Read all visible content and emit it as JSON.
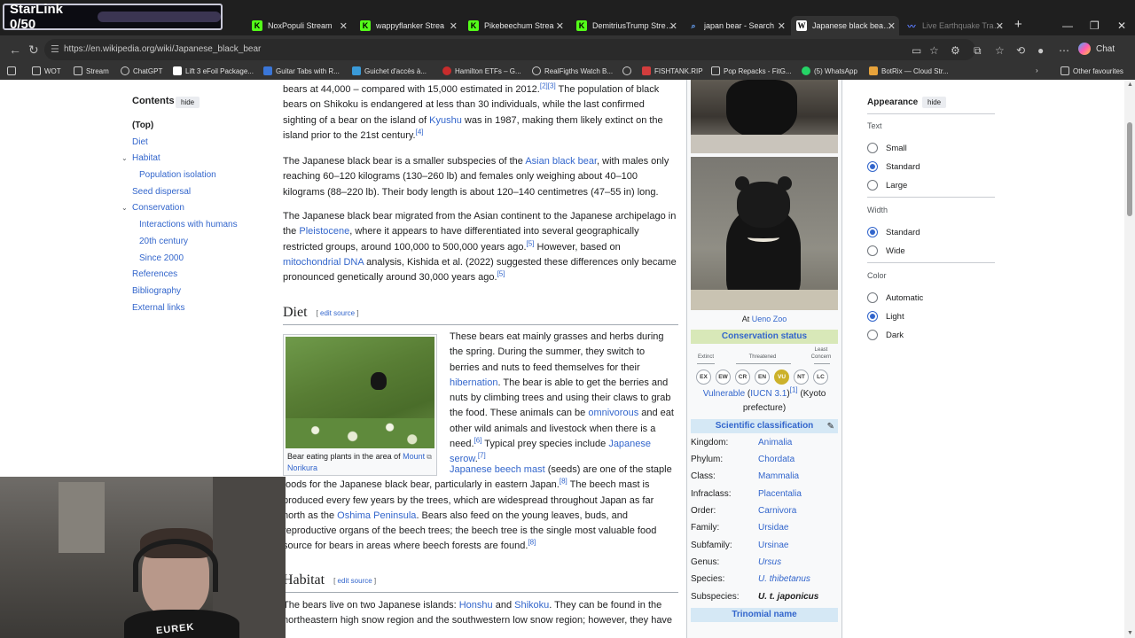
{
  "overlay": {
    "starlink_label": "StarLink 0/50"
  },
  "tabs": [
    {
      "label": "NoxPopuli Stream",
      "icon": "kick-icon",
      "color": "#53fc18"
    },
    {
      "label": "wappyflanker Strea",
      "icon": "kick-icon",
      "color": "#53fc18"
    },
    {
      "label": "Pikebeechum Strea",
      "icon": "kick-icon",
      "color": "#53fc18"
    },
    {
      "label": "DemitriusTrump Stream",
      "icon": "kick-icon",
      "color": "#53fc18"
    },
    {
      "label": "japan bear - Search",
      "icon": "search-icon",
      "color": "#3b82f6"
    },
    {
      "label": "Japanese black bear - W",
      "icon": "wikipedia-icon",
      "color": "#ffffff"
    },
    {
      "label": "Live Earthquake Tracke",
      "icon": "seismograph-icon",
      "color": "#5b7cff"
    }
  ],
  "address": {
    "url": "https://en.wikipedia.org/wiki/Japanese_black_bear"
  },
  "chat_label": "Chat",
  "bookmarks": [
    {
      "label": "WOT",
      "icon": "folder-icon"
    },
    {
      "label": "Stream",
      "icon": "folder-icon"
    },
    {
      "label": "ChatGPT",
      "icon": "chatgpt-icon"
    },
    {
      "label": "Lift 3 eFoil Package...",
      "icon": "wikipedia-icon"
    },
    {
      "label": "Guitar Tabs with R...",
      "icon": "tabs-icon"
    },
    {
      "label": "Guichet d'accès à...",
      "icon": "puzzle-icon"
    },
    {
      "label": "Hamilton ETFs – G...",
      "icon": "hamilton-icon"
    },
    {
      "label": "RealFigths Watch B...",
      "icon": "wordpress-icon"
    },
    {
      "label": "",
      "icon": "globe-icon"
    },
    {
      "label": "FISHTANK.RIP",
      "icon": "fish-icon"
    },
    {
      "label": "Pop Repacks - FitG...",
      "icon": "folder-icon"
    },
    {
      "label": "(5) WhatsApp",
      "icon": "whatsapp-icon"
    },
    {
      "label": "BotRix — Cloud Str...",
      "icon": "botrix-icon"
    }
  ],
  "other_favourites": "Other favourites",
  "toc": {
    "title": "Contents",
    "hide": "hide",
    "items": [
      {
        "label": "(Top)"
      },
      {
        "label": "Diet"
      },
      {
        "label": "Habitat"
      },
      {
        "label": "Population isolation"
      },
      {
        "label": "Seed dispersal"
      },
      {
        "label": "Conservation"
      },
      {
        "label": "Interactions with humans"
      },
      {
        "label": "20th century"
      },
      {
        "label": "Since 2000"
      },
      {
        "label": "References"
      },
      {
        "label": "Bibliography"
      },
      {
        "label": "External links"
      }
    ]
  },
  "article": {
    "p1": {
      "a": "bears at 44,000 – compared with 15,000 estimated in 2012.",
      "r1": "[2]",
      "r2": "[3]",
      "b": " The population of black bears on Shikoku is endangered at less than 30 individuals, while the last confirmed sighting of a bear on the island of ",
      "link": "Kyushu",
      "c": " was in 1987, making them likely extinct on the island prior to the 21st century.",
      "r3": "[4]"
    },
    "p2": {
      "a": "The Japanese black bear is a smaller subspecies of the ",
      "link": "Asian black bear",
      "b": ", with males only reaching 60–120 kilograms (130–260 lb) and females only weighing about 40–100 kilograms (88–220 lb). Their body length is about 120–140 centimetres (47–55 in) long."
    },
    "p3": {
      "a": "The Japanese black bear migrated from the Asian continent to the Japanese archipelago in the ",
      "link1": "Pleistocene",
      "b": ", where it appears to have differentiated into several geographically restricted groups, around 100,000 to 500,000 years ago.",
      "r1": "[5]",
      "c": " However, based on ",
      "link2": "mitochondrial DNA",
      "d": " analysis, Kishida et al. (2022) suggested these differences only became pronounced genetically around 30,000 years ago.",
      "r2": "[5]"
    },
    "diet_heading": "Diet",
    "edit_source": "edit source",
    "diet_p1": {
      "a": "These bears eat mainly grasses and herbs during the spring. During the summer, they switch to berries and nuts to feed themselves for their ",
      "link1": "hibernation",
      "b": ". The bear is able to get the berries and nuts by climbing trees and using their claws to grab the food. These animals can be ",
      "link2": "omnivorous",
      "c": " and eat other wild animals and livestock when there is a need.",
      "r1": "[6]",
      "d": " Typical prey species include ",
      "link3": "Japanese serow",
      "e": ".",
      "r2": "[7]"
    },
    "diet_p2": {
      "link1": "Japanese beech mast",
      "a": " (seeds) are one of the staple foods for the Japanese black bear, particularly in eastern Japan.",
      "r1": "[8]",
      "b": " The beech mast is produced every few years by the trees, which are widespread throughout Japan as far north as the ",
      "link2": "Oshima Peninsula",
      "c": ". Bears also feed on the young leaves, buds, and reproductive organs of the beech trees; the beech tree is the single most valuable food source for bears in areas where beech forests are found.",
      "r2": "[8]"
    },
    "figure": {
      "caption": "Bear eating plants in the area of ",
      "link": "Mount Norikura"
    },
    "habitat_heading": "Habitat",
    "habitat_p": {
      "a": "The bears live on two Japanese islands: ",
      "link1": "Honshu",
      "b": " and ",
      "link2": "Shikoku",
      "c": ". They can be found in the northeastern high snow region and the southwestern low snow region; however, they have"
    }
  },
  "infobox": {
    "caption_prefix": "At ",
    "caption_link": "Ueno Zoo",
    "conservation_status": "Conservation status",
    "labels": {
      "extinct": "Extinct",
      "threatened": "Threatened",
      "least_concern_1": "Least",
      "least_concern_2": "Concern"
    },
    "iucn_codes": [
      "EX",
      "EW",
      "CR",
      "EN",
      "VU",
      "NT",
      "LC"
    ],
    "iucn_selected": "VU",
    "status_link": "Vulnerable",
    "status_open": " (",
    "iucn_link": "IUCN 3.1",
    "status_ref": "[1]",
    "status_rest": " (Kyoto prefecture)",
    "status_close": ")",
    "sci_heading": "Scientific classification",
    "ranks": [
      {
        "rank": "Kingdom:",
        "value": "Animalia",
        "style": "link"
      },
      {
        "rank": "Phylum:",
        "value": "Chordata",
        "style": "link"
      },
      {
        "rank": "Class:",
        "value": "Mammalia",
        "style": "link"
      },
      {
        "rank": "Infraclass:",
        "value": "Placentalia",
        "style": "link"
      },
      {
        "rank": "Order:",
        "value": "Carnivora",
        "style": "link"
      },
      {
        "rank": "Family:",
        "value": "Ursidae",
        "style": "link"
      },
      {
        "rank": "Subfamily:",
        "value": "Ursinae",
        "style": "link"
      },
      {
        "rank": "Genus:",
        "value": "Ursus",
        "style": "italic-link"
      },
      {
        "rank": "Species:",
        "value": "U. thibetanus",
        "style": "italic-link"
      },
      {
        "rank": "Subspecies:",
        "value": "U. t. japonicus",
        "style": "bold-italic"
      }
    ],
    "trinomial": "Trinomial name"
  },
  "appearance": {
    "title": "Appearance",
    "hide": "hide",
    "text_label": "Text",
    "text_options": [
      "Small",
      "Standard",
      "Large"
    ],
    "text_selected": "Standard",
    "width_label": "Width",
    "width_options": [
      "Standard",
      "Wide"
    ],
    "width_selected": "Standard",
    "color_label": "Color",
    "color_options": [
      "Automatic",
      "Light",
      "Dark"
    ],
    "color_selected": "Light"
  },
  "webcam": {
    "shirt_text": "EUREK"
  }
}
